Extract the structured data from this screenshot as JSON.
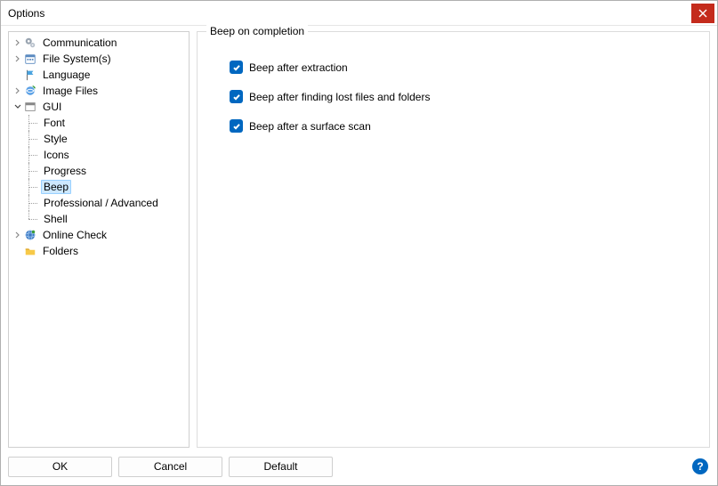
{
  "window": {
    "title": "Options"
  },
  "tree": {
    "items": [
      {
        "label": "Communication",
        "icon": "cogs",
        "expandable": true,
        "expanded": false
      },
      {
        "label": "File System(s)",
        "icon": "calendar",
        "expandable": true,
        "expanded": false
      },
      {
        "label": "Language",
        "icon": "flag",
        "expandable": false
      },
      {
        "label": "Image Files",
        "icon": "globe-refresh",
        "expandable": true,
        "expanded": false
      },
      {
        "label": "GUI",
        "icon": "window",
        "expandable": true,
        "expanded": true,
        "children": [
          {
            "label": "Font"
          },
          {
            "label": "Style"
          },
          {
            "label": "Icons"
          },
          {
            "label": "Progress"
          },
          {
            "label": "Beep",
            "selected": true
          },
          {
            "label": "Professional / Advanced"
          },
          {
            "label": "Shell"
          }
        ]
      },
      {
        "label": "Online Check",
        "icon": "globe",
        "expandable": true,
        "expanded": false
      },
      {
        "label": "Folders",
        "icon": "folder",
        "expandable": false
      }
    ]
  },
  "panel": {
    "group_title": "Beep on completion",
    "checkboxes": [
      {
        "label": "Beep after extraction",
        "checked": true
      },
      {
        "label": "Beep after finding lost files and folders",
        "checked": true
      },
      {
        "label": "Beep after a surface scan",
        "checked": true
      }
    ]
  },
  "footer": {
    "ok": "OK",
    "cancel": "Cancel",
    "default": "Default",
    "help": "?"
  }
}
